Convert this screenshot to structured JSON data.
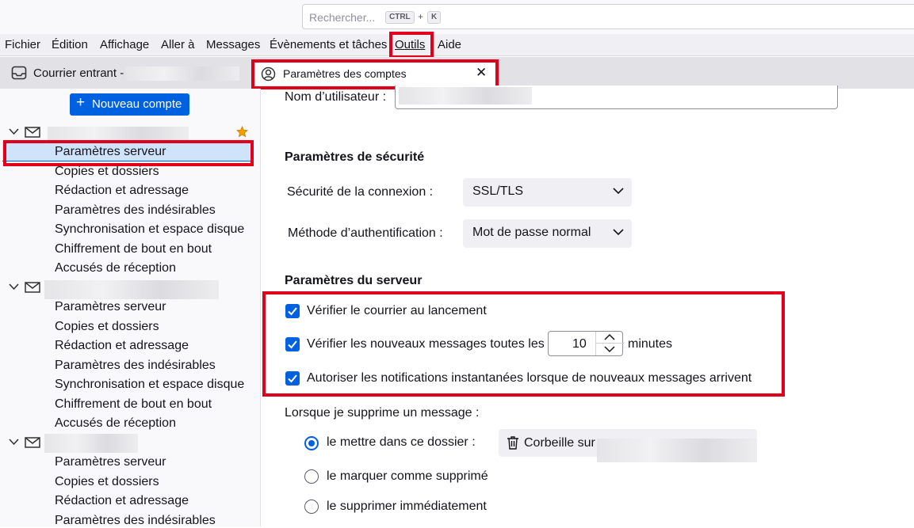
{
  "search": {
    "placeholder": "Rechercher...",
    "key1": "CTRL",
    "plus": "+",
    "key2": "K"
  },
  "menubar": [
    "Fichier",
    "Édition",
    "Affichage",
    "Aller à",
    "Messages",
    "Évènements et tâches",
    "Outils",
    "Aide"
  ],
  "tabs": [
    {
      "label": "Courrier entrant -"
    },
    {
      "label": "Paramètres des comptes",
      "close": "✕"
    }
  ],
  "sidebar": {
    "new_account": "Nouveau compte",
    "account_sections": [
      {
        "items": [
          "Paramètres serveur",
          "Copies et dossiers",
          "Rédaction et adressage",
          "Paramètres des indésirables",
          "Synchronisation et espace disque",
          "Chiffrement de bout en bout",
          "Accusés de réception"
        ]
      },
      {
        "items": [
          "Paramètres serveur",
          "Copies et dossiers",
          "Rédaction et adressage",
          "Paramètres des indésirables",
          "Synchronisation et espace disque",
          "Chiffrement de bout en bout",
          "Accusés de réception"
        ]
      },
      {
        "items": [
          "Paramètres serveur",
          "Copies et dossiers",
          "Rédaction et adressage",
          "Paramètres des indésirables"
        ]
      }
    ]
  },
  "main": {
    "username_label": "Nom d’utilisateur :",
    "security_heading": "Paramètres de sécurité",
    "connection_security_label": "Sécurité de la connexion :",
    "connection_security_value": "SSL/TLS",
    "auth_method_label": "Méthode d’authentification :",
    "auth_method_value": "Mot de passe normal",
    "server_heading": "Paramètres du serveur",
    "check_on_startup": "Vérifier le courrier au lancement",
    "check_every_prefix": "Vérifier les nouveaux messages toutes les",
    "check_every_value": "10",
    "check_every_suffix": "minutes",
    "allow_push": "Autoriser les notifications instantanées lorsque de nouveaux messages arrivent",
    "delete_heading": "Lorsque je supprime un message :",
    "radio_move": "le mettre dans ce dossier :",
    "trash_folder": "Corbeille sur",
    "radio_mark": "le marquer comme supprimé",
    "radio_delete": "le supprimer immédiatement"
  },
  "colors": {
    "accent": "#0061e0",
    "highlight_box": "#e0001b",
    "selection": "#cfe3fa"
  }
}
